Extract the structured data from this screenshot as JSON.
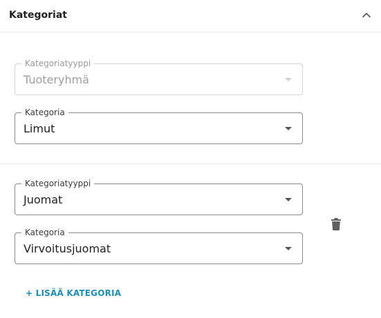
{
  "header": {
    "title": "Kategoriat",
    "toggle_icon": "chevron-up-icon"
  },
  "groups": [
    {
      "type_field": {
        "label": "Kategoriatyyppi",
        "value": "Tuoteryhmä",
        "disabled": true
      },
      "category_field": {
        "label": "Kategoria",
        "value": "Limut",
        "disabled": false
      }
    },
    {
      "type_field": {
        "label": "Kategoriatyyppi",
        "value": "Juomat",
        "disabled": false
      },
      "category_field": {
        "label": "Kategoria",
        "value": "Virvoitusjuomat",
        "disabled": false
      },
      "delete_icon": "trash-icon"
    }
  ],
  "add_button": {
    "label": "+ LISÄÄ KATEGORIA"
  },
  "colors": {
    "accent": "#1a8fb8",
    "border": "#8c8c8c",
    "disabled_border": "#d4d4d4",
    "divider": "#e6e6e6"
  }
}
